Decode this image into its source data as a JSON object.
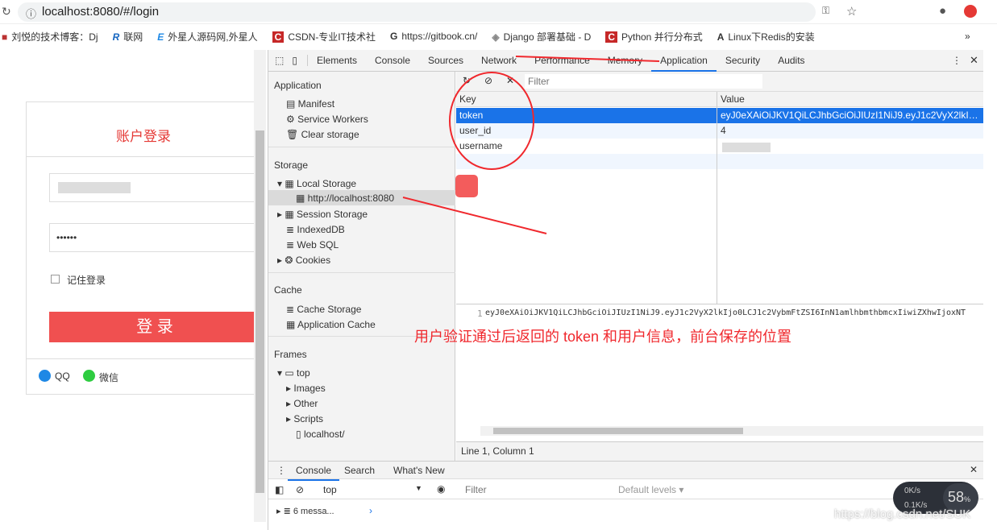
{
  "browser": {
    "url": "localhost:8080/#/login",
    "bookmarks": [
      {
        "icon": "blog-icon",
        "label": "刘悦的技术博客：Dj"
      },
      {
        "icon": "R",
        "label": "联网"
      },
      {
        "icon": "E",
        "label": "外星人源码网,外星人"
      },
      {
        "icon": "C",
        "label": "CSDN-专业IT技术社"
      },
      {
        "icon": "G",
        "label": "https://gitbook.cn/"
      },
      {
        "icon": "django-icon",
        "label": "Django 部署基础 - D"
      },
      {
        "icon": "C",
        "label": "Python 并行分布式"
      },
      {
        "icon": "A",
        "label": "Linux下Redis的安装"
      }
    ],
    "more": "»"
  },
  "login": {
    "title": "账户登录",
    "password_value": "••••••",
    "remember": "记住登录",
    "submit": "登 录",
    "qq": "QQ",
    "wechat": "微信"
  },
  "devtools": {
    "tabs": [
      "Elements",
      "Console",
      "Sources",
      "Network",
      "Performance",
      "Memory",
      "Application",
      "Security",
      "Audits"
    ],
    "active_tab": "Application",
    "sidebar": {
      "application_header": "Application",
      "application_items": [
        "Manifest",
        "Service Workers",
        "Clear storage"
      ],
      "storage_header": "Storage",
      "local_storage": "Local Storage",
      "local_origin": "http://localhost:8080",
      "session_storage": "Session Storage",
      "indexeddb": "IndexedDB",
      "websql": "Web SQL",
      "cookies": "Cookies",
      "cache_header": "Cache",
      "cache_storage": "Cache Storage",
      "app_cache": "Application Cache",
      "frames_header": "Frames",
      "top": "top",
      "images": "Images",
      "other": "Other",
      "scripts": "Scripts",
      "localhost": "localhost/"
    },
    "filter_placeholder": "Filter",
    "table": {
      "key_header": "Key",
      "value_header": "Value",
      "rows": [
        {
          "key": "token",
          "value": "eyJ0eXAiOiJKV1QiLCJhbGciOiJIUzI1NiJ9.eyJ1c2VyX2lkIjo0LCJ..."
        },
        {
          "key": "user_id",
          "value": "4"
        },
        {
          "key": "username",
          "value": ""
        }
      ]
    },
    "preview": {
      "line_no": "1",
      "text": "eyJ0eXAiOiJKV1QiLCJhbGciOiJIUzI1NiJ9.eyJ1c2VyX2lkIjo0LCJ1c2VybmFtZSI6InN1amlhbmthbmcxIiwiZXhwIjoxNT"
    },
    "status": "Line 1, Column 1",
    "drawer": {
      "tabs": [
        "Console",
        "Search",
        "What's New"
      ],
      "context": "top",
      "filter_placeholder": "Filter",
      "levels": "Default levels ▾",
      "messages": "6 messa..."
    }
  },
  "annotation": "用户验证通过后返回的 token 和用户信息，前台保存的位置",
  "overlay": {
    "up": "0K/s",
    "down": "0.1K/s",
    "cpu": "58",
    "unit": "%"
  },
  "watermark": "https://blog.csdn.net/SUK"
}
